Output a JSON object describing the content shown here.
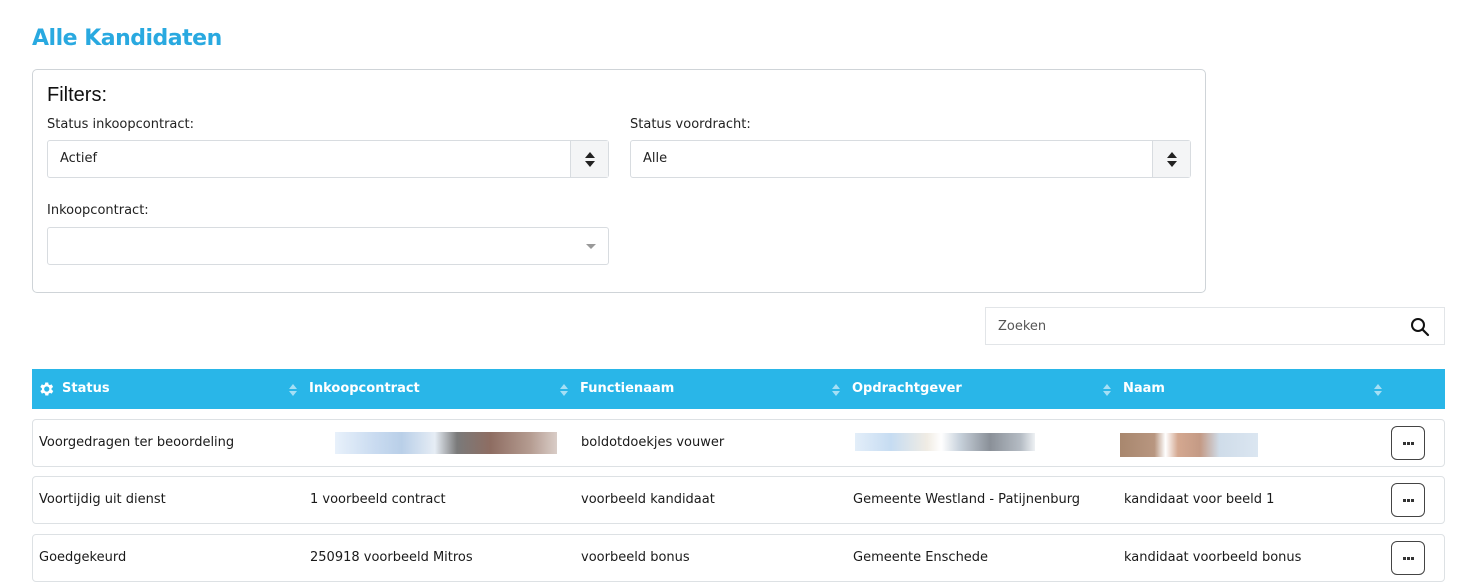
{
  "page": {
    "title": "Alle Kandidaten"
  },
  "filters": {
    "title": "Filters:",
    "status_inkoopcontract": {
      "label": "Status inkoopcontract:",
      "value": "Actief"
    },
    "status_voordracht": {
      "label": "Status voordracht:",
      "value": "Alle"
    },
    "inkoopcontract": {
      "label": "Inkoopcontract:",
      "value": ""
    }
  },
  "search": {
    "placeholder": "Zoeken",
    "icon": "search-icon"
  },
  "table": {
    "header_color": "#29b6e8",
    "columns": [
      "Status",
      "Inkoopcontract",
      "Functienaam",
      "Opdrachtgever",
      "Naam"
    ],
    "rows": [
      {
        "status": "Voorgedragen ter beoordeling",
        "inkoopcontract": "",
        "functienaam": "boldotdoekjes vouwer",
        "opdrachtgever": "",
        "naam": ""
      },
      {
        "status": "Voortijdig uit dienst",
        "inkoopcontract": "1 voorbeeld contract",
        "functienaam": "voorbeeld kandidaat",
        "opdrachtgever": "Gemeente Westland - Patijnenburg",
        "naam": "kandidaat voor beeld 1"
      },
      {
        "status": "Goedgekeurd",
        "inkoopcontract": "250918 voorbeeld Mitros",
        "functienaam": "voorbeeld bonus",
        "opdrachtgever": "Gemeente Enschede",
        "naam": "kandidaat voorbeeld bonus"
      }
    ]
  },
  "colors": {
    "accent": "#29a9e0"
  }
}
